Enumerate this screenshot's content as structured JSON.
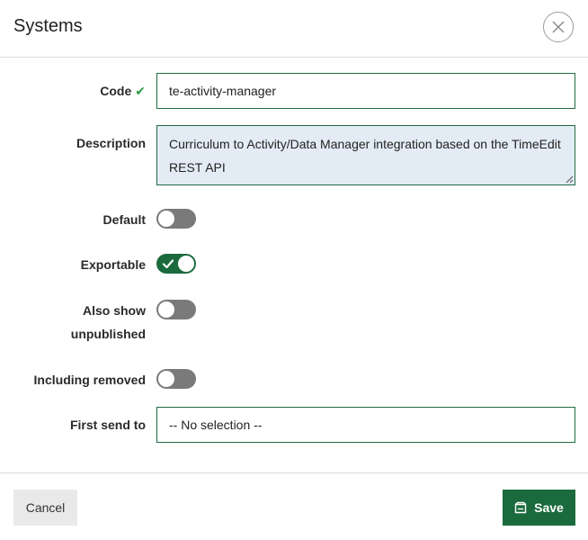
{
  "dialog": {
    "title": "Systems"
  },
  "form": {
    "code": {
      "label": "Code",
      "value": "te-activity-manager"
    },
    "description": {
      "label": "Description",
      "value": "Curriculum to Activity/Data Manager integration based on the TimeEdit REST API"
    },
    "default": {
      "label": "Default",
      "on": false
    },
    "exportable": {
      "label": "Exportable",
      "on": true
    },
    "also_show_unpublished": {
      "label_line1": "Also show",
      "label_line2": "unpublished",
      "on": false
    },
    "including_removed": {
      "label": "Including removed",
      "on": false
    },
    "first_send_to": {
      "label": "First send to",
      "value": "-- No selection --"
    }
  },
  "footer": {
    "cancel_label": "Cancel",
    "save_label": "Save"
  },
  "icons": {
    "close": "close-icon",
    "code_valid": "check-icon",
    "save": "save-icon"
  },
  "colors": {
    "accent": "#1b6a3d",
    "valid_check": "#2e9a43",
    "toggle_off": "#7a7a7a",
    "textarea_bg": "#e3ecf5"
  }
}
